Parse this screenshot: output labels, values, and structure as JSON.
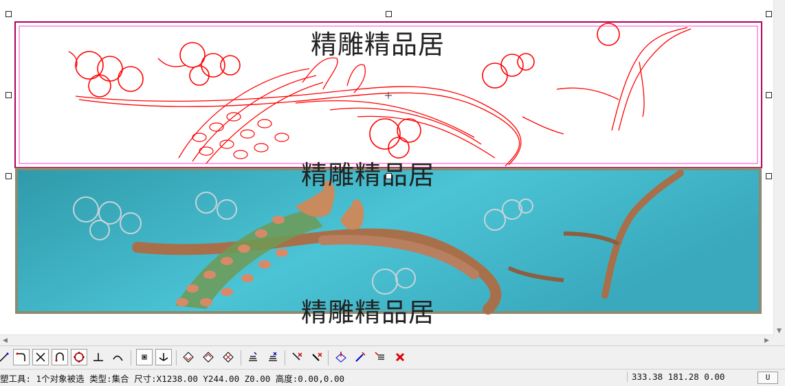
{
  "watermarks": {
    "top": "精雕精品居",
    "middle": "精雕精品居",
    "bottom": "精雕精品居"
  },
  "colors": {
    "vector": "#ff0000",
    "relief_bg": "#45b7cd",
    "frame": "#8a8a72",
    "selection": "#b0005a",
    "pink": "#ff44cc"
  },
  "toolbar": {
    "icons": [
      "curve-select-icon",
      "arc-icon",
      "cross-icon",
      "loop-icon",
      "circle-target-icon",
      "perpendicular-icon",
      "sweep-icon",
      "node-icon",
      "angle-icon",
      "diamond-icon-1",
      "diamond-icon-2",
      "diamond-icon-3",
      "layer-stack-icon",
      "layer-stack-2-icon",
      "mark-cross-icon",
      "mark-cross-2-icon",
      "transform-icon",
      "pen-icon",
      "edit-list-icon",
      "delete-icon"
    ]
  },
  "status": {
    "text": "塑工具: 1个对象被选 类型:集合 尺寸:X1238.00 Y244.00 Z0.00 高度:0.00,0.00",
    "coords": "333.38 181.28 0.00",
    "mode": "U"
  }
}
